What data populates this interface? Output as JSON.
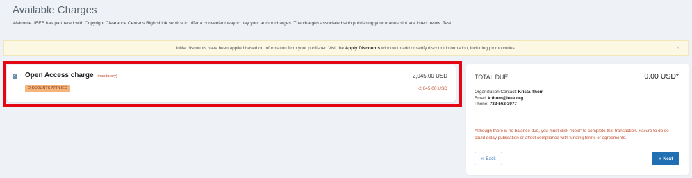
{
  "page": {
    "title": "Available Charges",
    "intro": "Welcome. IEEE has partnered with Copyright Clearance Center's RightsLink service to offer a convenient way to pay your author charges. The charges associated with publishing your manuscript are listed below. Test"
  },
  "notice": {
    "text_before": "Initial discounts have been applied based on information from your publisher. Visit the ",
    "link_text": "Apply Discounts",
    "text_after": " window to add or verify discount information, including promo codes.",
    "close": "×"
  },
  "charge": {
    "name": "Open Access charge",
    "mandatory": "(mandatory)",
    "badge": "DISCOUNTS APPLIED",
    "price": "2,045.00 USD",
    "discount": "-2,045.00 USD",
    "checked": true,
    "check_glyph": "✓"
  },
  "summary": {
    "total_label": "TOTAL DUE:",
    "total_amount": "0.00 USD*",
    "contact_label": "Organization Contact:",
    "contact_name": "Krista Thom",
    "email_label": "Email:",
    "email": "k.thom@ieee.org",
    "phone_label": "Phone:",
    "phone": "732-562-3977",
    "warning": "Although there is no balance due, you must click \"Next\" to complete this transaction. Failure to do so could delay publication or affect compliance with funding terms or agreements."
  },
  "buttons": {
    "back": "Back",
    "back_icon": "«",
    "next": "Next",
    "next_icon": "»"
  },
  "colors": {
    "accent": "#1f6fb2",
    "warning_text": "#c0502f",
    "badge_bg": "#f6b47c",
    "highlight": "#e30613",
    "notice_bg": "#fcf8e3"
  }
}
